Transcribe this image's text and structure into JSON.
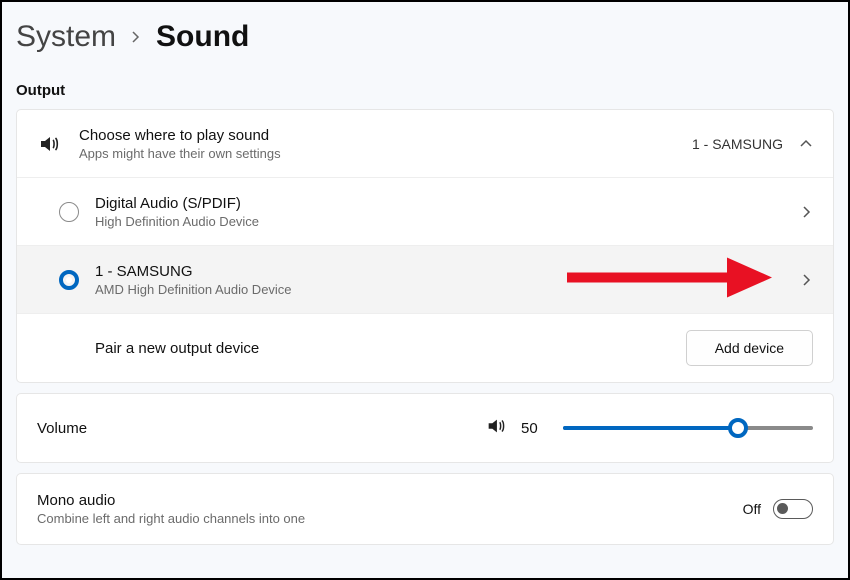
{
  "breadcrumb": {
    "parent": "System",
    "current": "Sound"
  },
  "output": {
    "section_label": "Output",
    "choose": {
      "title": "Choose where to play sound",
      "subtitle": "Apps might have their own settings",
      "current_value": "1 - SAMSUNG"
    },
    "devices": [
      {
        "name": "Digital Audio (S/PDIF)",
        "driver": "High Definition Audio Device",
        "selected": false
      },
      {
        "name": "1 - SAMSUNG",
        "driver": "AMD High Definition Audio Device",
        "selected": true
      }
    ],
    "pair": {
      "label": "Pair a new output device",
      "button": "Add device"
    }
  },
  "volume": {
    "label": "Volume",
    "value": "50",
    "percent": 70
  },
  "mono": {
    "title": "Mono audio",
    "subtitle": "Combine left and right audio channels into one",
    "state_label": "Off",
    "on": false
  }
}
